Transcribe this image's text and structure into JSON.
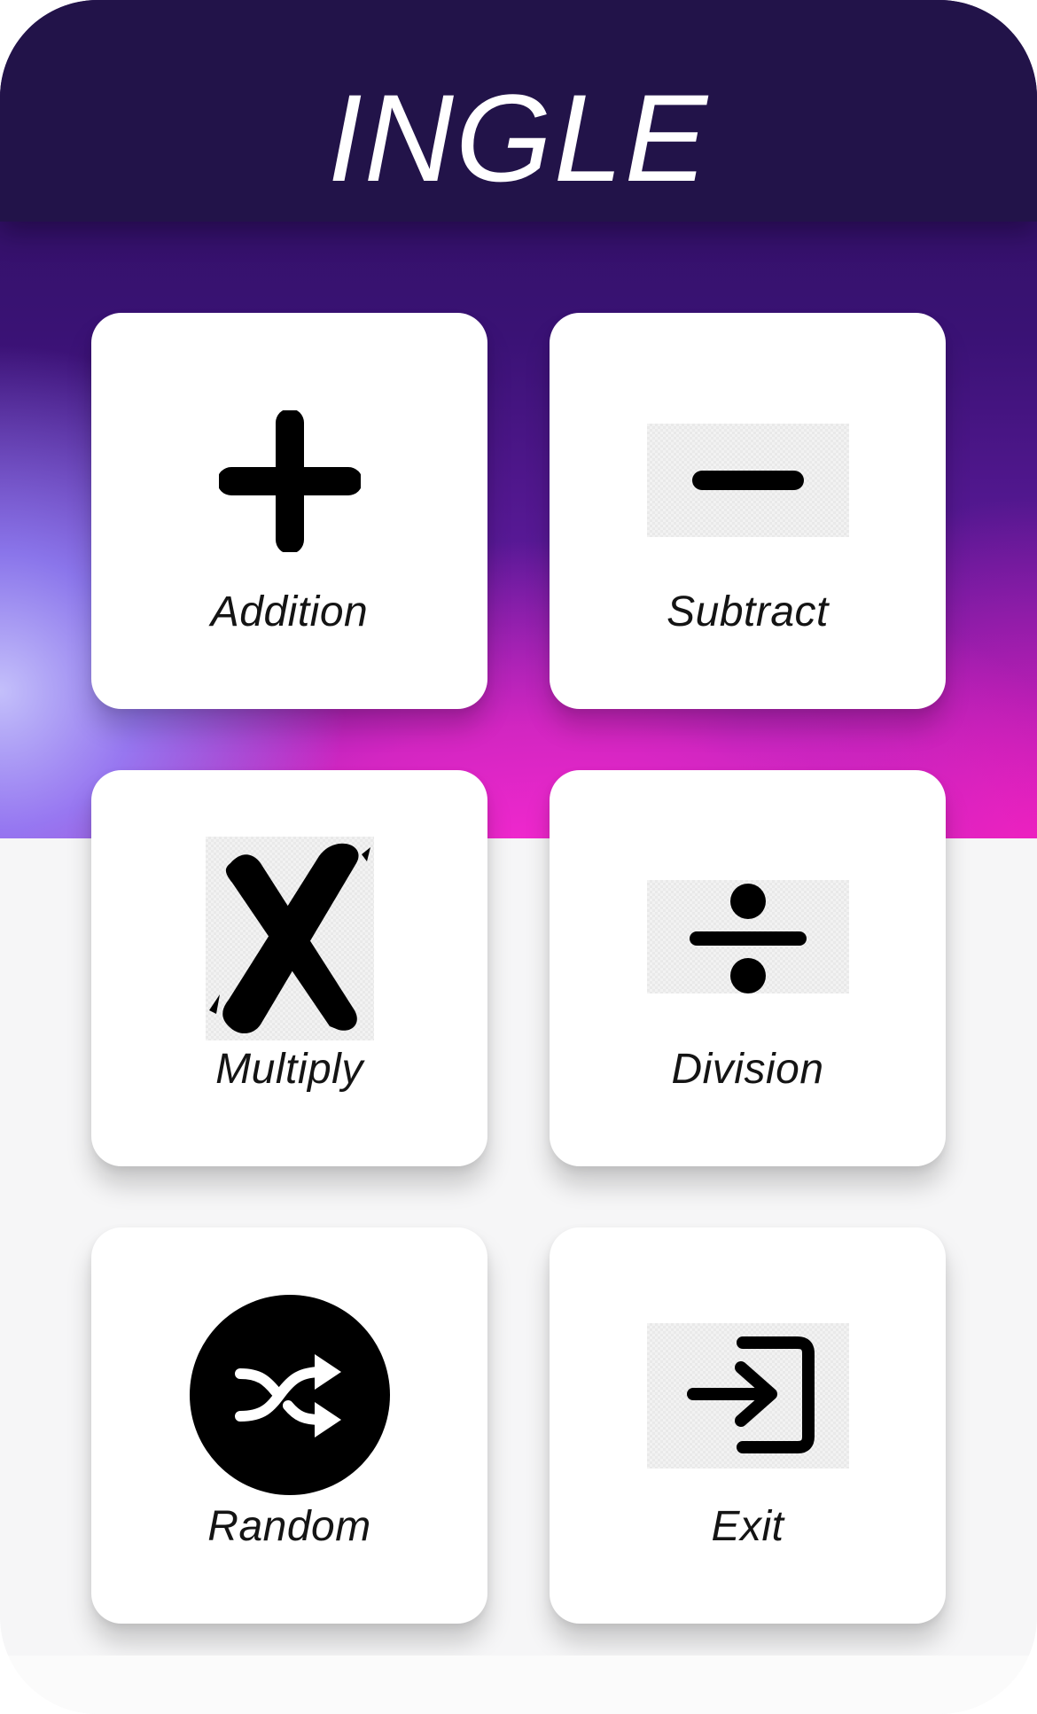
{
  "app": {
    "title": "INGLE"
  },
  "menu": {
    "items": [
      {
        "id": "addition",
        "label": "Addition",
        "icon": "plus-icon"
      },
      {
        "id": "subtract",
        "label": "Subtract",
        "icon": "minus-icon"
      },
      {
        "id": "multiply",
        "label": "Multiply",
        "icon": "multiply-icon"
      },
      {
        "id": "division",
        "label": "Division",
        "icon": "divide-icon"
      },
      {
        "id": "random",
        "label": "Random",
        "icon": "shuffle-icon"
      },
      {
        "id": "exit",
        "label": "Exit",
        "icon": "exit-icon"
      }
    ]
  },
  "colors": {
    "title_bar": "#221349",
    "accent_pink": "#ff28d2",
    "accent_violet": "#8a22b8",
    "card": "#ffffff",
    "icon": "#000000"
  }
}
